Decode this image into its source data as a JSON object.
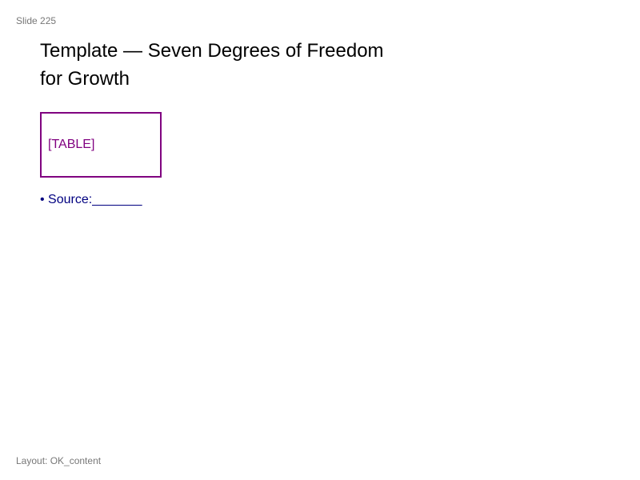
{
  "slide": {
    "number_label": "Slide 225",
    "title_line1": "Template — Seven Degrees of Freedom",
    "title_line2": "for Growth",
    "table_placeholder": "[TABLE]",
    "bullets": [
      {
        "marker": "• ",
        "text": "Source:_______"
      }
    ],
    "layout_label": "Layout: OK_content"
  },
  "colors": {
    "placeholder_border": "#800080",
    "placeholder_text": "#800080",
    "bullet_text": "#000080",
    "meta_text": "#777777",
    "title_text": "#000000"
  }
}
